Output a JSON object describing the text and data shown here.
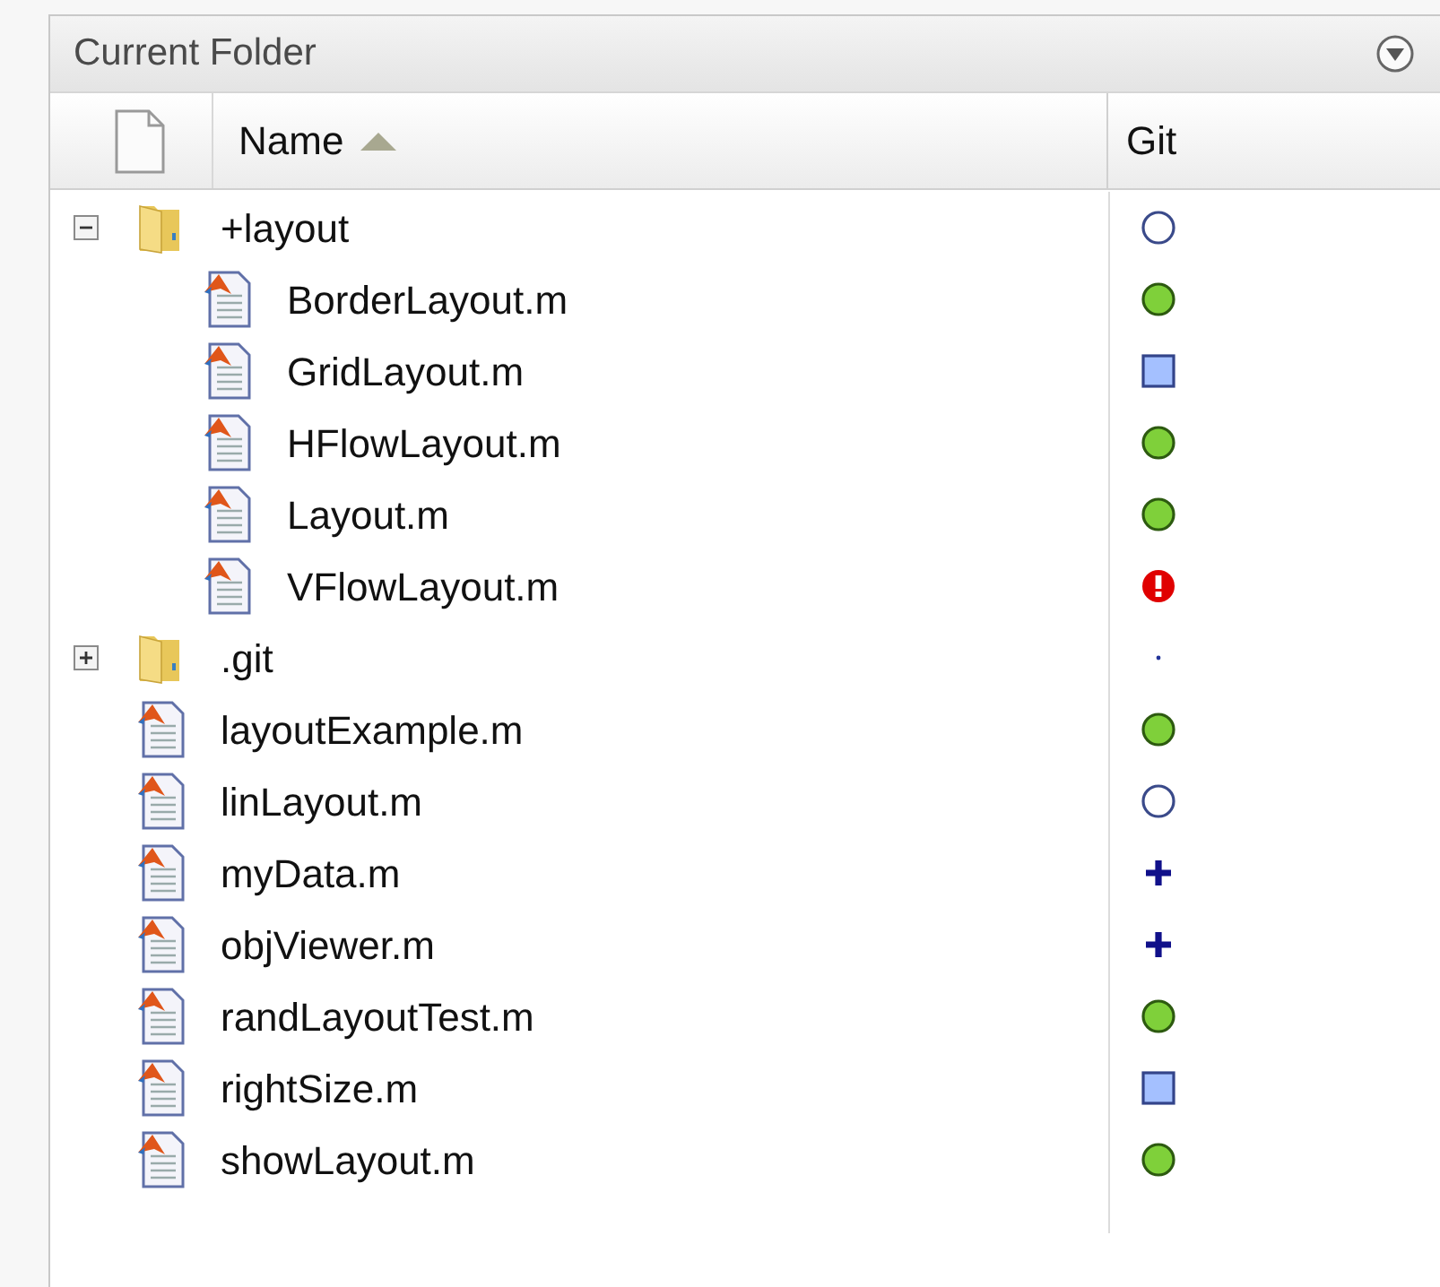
{
  "panel": {
    "title": "Current Folder"
  },
  "columns": [
    {
      "label": "Name",
      "sorted": true
    },
    {
      "label": "Git",
      "sorted": false
    }
  ],
  "tree": [
    {
      "kind": "folder",
      "name": "+layout",
      "git": {
        "kind": "untracked"
      },
      "expanded": true,
      "children": [
        {
          "kind": "file",
          "name": "BorderLayout.m",
          "git": {
            "kind": "unmodified"
          }
        },
        {
          "kind": "file",
          "name": "GridLayout.m",
          "git": {
            "kind": "modified"
          }
        },
        {
          "kind": "file",
          "name": "HFlowLayout.m",
          "git": {
            "kind": "unmodified"
          }
        },
        {
          "kind": "file",
          "name": "Layout.m",
          "git": {
            "kind": "unmodified"
          }
        },
        {
          "kind": "file",
          "name": "VFlowLayout.m",
          "git": {
            "kind": "conflict"
          }
        }
      ]
    },
    {
      "kind": "folder",
      "name": ".git",
      "git": {
        "kind": "ignored"
      },
      "expanded": false
    },
    {
      "kind": "file",
      "name": "layoutExample.m",
      "git": {
        "kind": "unmodified"
      }
    },
    {
      "kind": "file",
      "name": "linLayout.m",
      "git": {
        "kind": "untracked"
      }
    },
    {
      "kind": "file",
      "name": "myData.m",
      "git": {
        "kind": "added"
      }
    },
    {
      "kind": "file",
      "name": "objViewer.m",
      "git": {
        "kind": "added"
      }
    },
    {
      "kind": "file",
      "name": "randLayoutTest.m",
      "git": {
        "kind": "unmodified"
      }
    },
    {
      "kind": "file",
      "name": "rightSize.m",
      "git": {
        "kind": "modified"
      }
    },
    {
      "kind": "file",
      "name": "showLayout.m",
      "git": {
        "kind": "unmodified"
      }
    }
  ]
}
